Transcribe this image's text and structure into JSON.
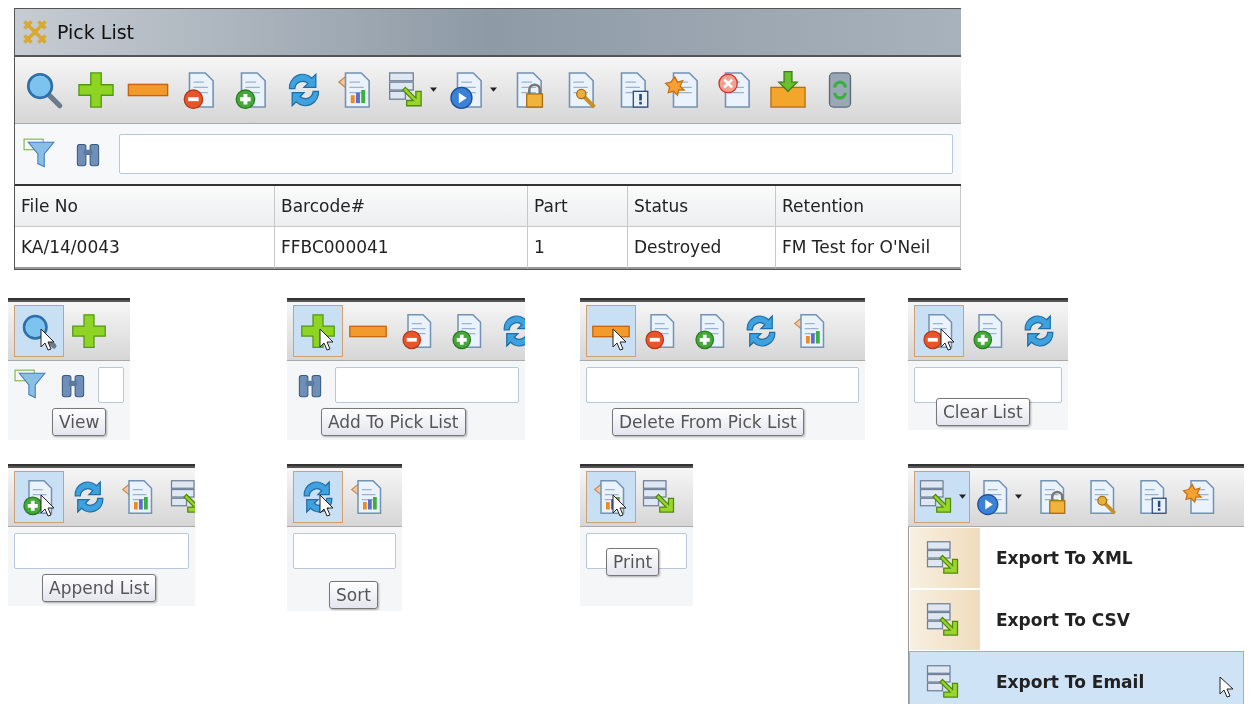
{
  "window": {
    "title": "Pick List"
  },
  "toolbar": {
    "buttons": [
      {
        "kind": "view",
        "has_menu": false,
        "highlighted": false
      },
      {
        "kind": "add",
        "has_menu": false,
        "highlighted": false
      },
      {
        "kind": "remove",
        "has_menu": false,
        "highlighted": false
      },
      {
        "kind": "clear",
        "has_menu": false,
        "highlighted": false
      },
      {
        "kind": "append",
        "has_menu": false,
        "highlighted": false
      },
      {
        "kind": "sort",
        "has_menu": false,
        "highlighted": false
      },
      {
        "kind": "print",
        "has_menu": false,
        "highlighted": false
      },
      {
        "kind": "export",
        "has_menu": true,
        "highlighted": false
      },
      {
        "kind": "run",
        "has_menu": true,
        "highlighted": false
      },
      {
        "kind": "lock",
        "has_menu": false,
        "highlighted": false
      },
      {
        "kind": "key",
        "has_menu": false,
        "highlighted": false
      },
      {
        "kind": "alert",
        "has_menu": false,
        "highlighted": false
      },
      {
        "kind": "burst",
        "has_menu": false,
        "highlighted": false
      },
      {
        "kind": "cancel",
        "has_menu": false,
        "highlighted": false
      },
      {
        "kind": "box",
        "has_menu": false,
        "highlighted": false
      },
      {
        "kind": "cylinder",
        "has_menu": false,
        "highlighted": false
      }
    ]
  },
  "filter_bar": {
    "icons": [
      {
        "kind": "funnel"
      },
      {
        "kind": "binoculars"
      }
    ]
  },
  "table": {
    "columns": [
      "File No",
      "Barcode#",
      "Part",
      "Status",
      "Retention"
    ],
    "rows": [
      [
        "KA/14/0043",
        "FFBC000041",
        "1",
        "Destroyed",
        "FM Test for O'Neil"
      ]
    ]
  },
  "examples": [
    {
      "tooltip": "View",
      "buttons": [
        {
          "kind": "view",
          "has_menu": false,
          "highlighted": true
        },
        {
          "kind": "add",
          "has_menu": false,
          "highlighted": false
        }
      ],
      "filter_icons": [
        {
          "kind": "funnel"
        },
        {
          "kind": "binoculars"
        }
      ]
    },
    {
      "tooltip": "Add To Pick List",
      "buttons": [
        {
          "kind": "add",
          "has_menu": false,
          "highlighted": true
        },
        {
          "kind": "remove",
          "has_menu": false,
          "highlighted": false
        },
        {
          "kind": "clear",
          "has_menu": false,
          "highlighted": false
        },
        {
          "kind": "append",
          "has_menu": false,
          "highlighted": false
        },
        {
          "kind": "sort",
          "has_menu": false,
          "highlighted": false
        }
      ],
      "filter_icons": [
        {
          "kind": "binoculars"
        }
      ]
    },
    {
      "tooltip": "Delete From Pick List",
      "buttons": [
        {
          "kind": "remove",
          "has_menu": false,
          "highlighted": true
        },
        {
          "kind": "clear",
          "has_menu": false,
          "highlighted": false
        },
        {
          "kind": "append",
          "has_menu": false,
          "highlighted": false
        },
        {
          "kind": "sort",
          "has_menu": false,
          "highlighted": false
        },
        {
          "kind": "print",
          "has_menu": false,
          "highlighted": false
        }
      ]
    },
    {
      "tooltip": "Clear List",
      "buttons": [
        {
          "kind": "clear",
          "has_menu": false,
          "highlighted": true
        },
        {
          "kind": "append",
          "has_menu": false,
          "highlighted": false
        },
        {
          "kind": "sort",
          "has_menu": false,
          "highlighted": false
        }
      ]
    },
    {
      "tooltip": "Append List",
      "buttons": [
        {
          "kind": "append",
          "has_menu": false,
          "highlighted": true
        },
        {
          "kind": "sort",
          "has_menu": false,
          "highlighted": false
        },
        {
          "kind": "print",
          "has_menu": false,
          "highlighted": false
        },
        {
          "kind": "export",
          "has_menu": false,
          "highlighted": false
        }
      ]
    },
    {
      "tooltip": "Sort",
      "buttons": [
        {
          "kind": "sort",
          "has_menu": false,
          "highlighted": true
        },
        {
          "kind": "print",
          "has_menu": false,
          "highlighted": false
        }
      ]
    },
    {
      "tooltip": "Print",
      "buttons": [
        {
          "kind": "print",
          "has_menu": false,
          "highlighted": true
        },
        {
          "kind": "export",
          "has_menu": false,
          "highlighted": false
        }
      ]
    },
    {
      "buttons": [
        {
          "kind": "export",
          "has_menu": true,
          "highlighted": true
        },
        {
          "kind": "run",
          "has_menu": true,
          "highlighted": false
        },
        {
          "kind": "lock",
          "has_menu": false,
          "highlighted": false
        },
        {
          "kind": "key",
          "has_menu": false,
          "highlighted": false
        },
        {
          "kind": "alert",
          "has_menu": false,
          "highlighted": false
        },
        {
          "kind": "burst",
          "has_menu": false,
          "highlighted": false
        }
      ],
      "menu": {
        "items": [
          {
            "label": "Export To XML",
            "selected": false
          },
          {
            "label": "Export To CSV",
            "selected": false
          },
          {
            "label": "Export To Email",
            "selected": true
          }
        ]
      }
    }
  ]
}
